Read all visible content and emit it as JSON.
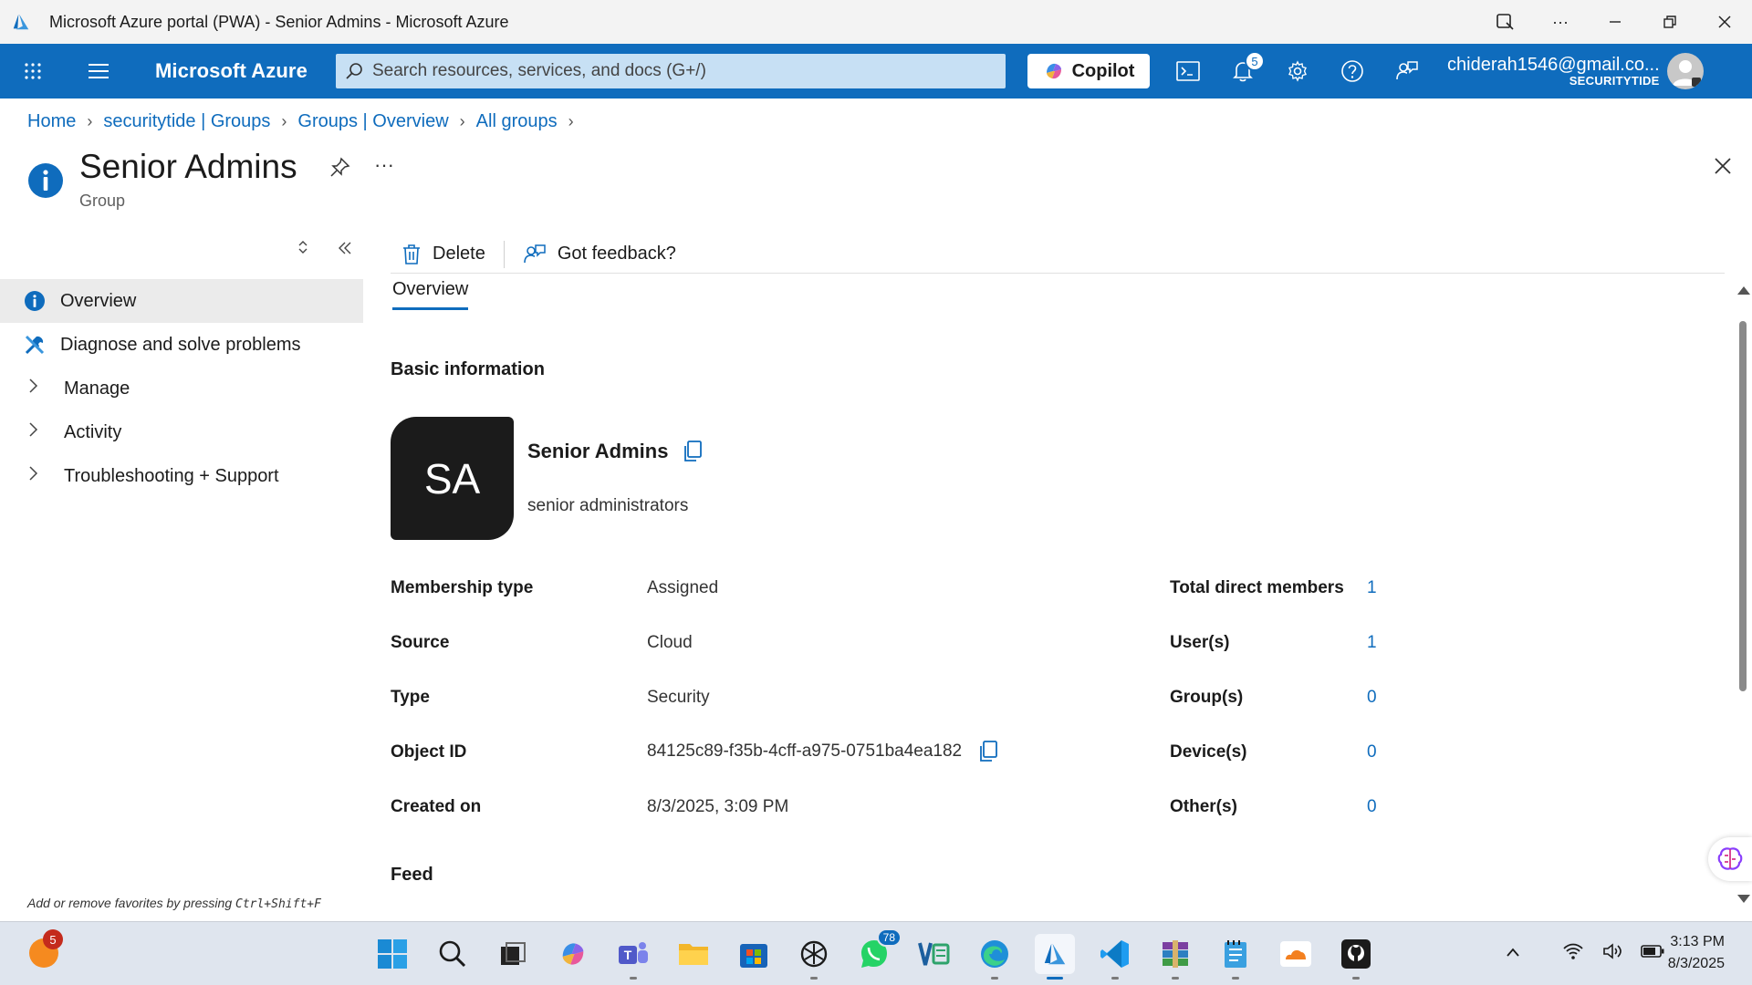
{
  "window": {
    "title": "Microsoft Azure portal (PWA) - Senior Admins - Microsoft Azure"
  },
  "topnav": {
    "brand": "Microsoft Azure",
    "search_placeholder": "Search resources, services, and docs (G+/)",
    "copilot_label": "Copilot",
    "notifications_count": "5",
    "account_email": "chiderah1546@gmail.co...",
    "account_tenant": "SECURITYTIDE"
  },
  "breadcrumb": [
    "Home",
    "securitytide | Groups",
    "Groups | Overview",
    "All groups"
  ],
  "page": {
    "title": "Senior Admins",
    "subtitle": "Group"
  },
  "leftmenu": {
    "items": [
      {
        "label": "Overview",
        "icon": "info-icon",
        "active": true
      },
      {
        "label": "Diagnose and solve problems",
        "icon": "wrench-icon"
      },
      {
        "label": "Manage",
        "icon": "chevron-right-icon"
      },
      {
        "label": "Activity",
        "icon": "chevron-right-icon"
      },
      {
        "label": "Troubleshooting + Support",
        "icon": "chevron-right-icon"
      }
    ],
    "hint_prefix": "Add or remove favorites by pressing ",
    "hint_keys": "Ctrl+Shift+F"
  },
  "toolbar": {
    "delete_label": "Delete",
    "feedback_label": "Got feedback?"
  },
  "overview": {
    "tab_label": "Overview",
    "section_title": "Basic information",
    "tile_initials": "SA",
    "group_name": "Senior Admins",
    "group_description": "senior administrators",
    "properties": [
      {
        "label": "Membership type",
        "value": "Assigned"
      },
      {
        "label": "Source",
        "value": "Cloud"
      },
      {
        "label": "Type",
        "value": "Security"
      },
      {
        "label": "Object ID",
        "value": "84125c89-f35b-4cff-a975-0751ba4ea182"
      },
      {
        "label": "Created on",
        "value": "8/3/2025, 3:09 PM"
      }
    ],
    "stats": [
      {
        "label": "Total direct members",
        "value": "1"
      },
      {
        "label": "User(s)",
        "value": "1"
      },
      {
        "label": "Group(s)",
        "value": "0"
      },
      {
        "label": "Device(s)",
        "value": "0"
      },
      {
        "label": "Other(s)",
        "value": "0"
      }
    ],
    "feed_title": "Feed"
  },
  "taskbar": {
    "weather_badge": "5",
    "whatsapp_badge": "78",
    "time": "3:13 PM",
    "date": "8/3/2025"
  },
  "colors": {
    "azure_blue": "#0f6cbd",
    "search_bg": "#c7e0f4",
    "tile_bg": "#1b1b1b"
  }
}
